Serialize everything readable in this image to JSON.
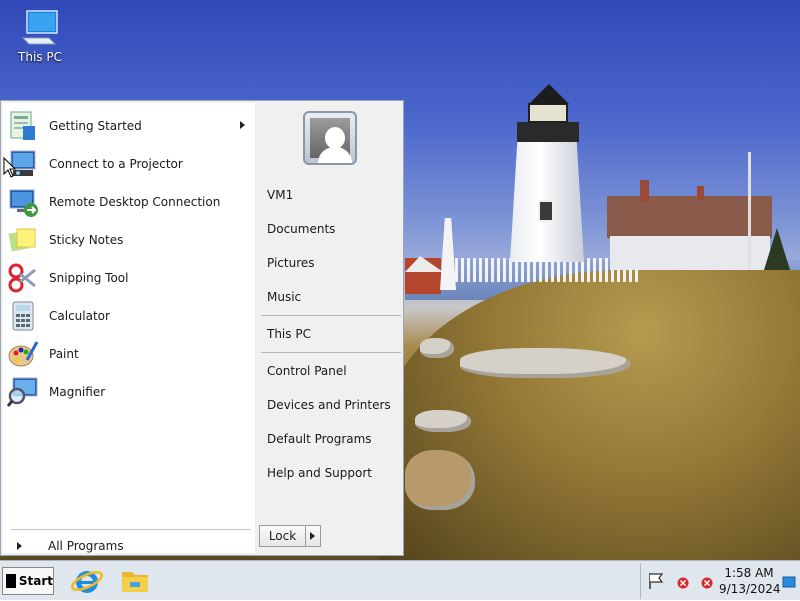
{
  "desktop": {
    "icons": [
      {
        "label": "This PC",
        "icon": "computer-icon"
      }
    ]
  },
  "start_menu": {
    "programs": [
      {
        "label": "Getting Started",
        "icon": "getting-started-icon",
        "has_submenu": true
      },
      {
        "label": "Connect to a Projector",
        "icon": "projector-icon"
      },
      {
        "label": "Remote Desktop Connection",
        "icon": "remote-desktop-icon"
      },
      {
        "label": "Sticky Notes",
        "icon": "sticky-notes-icon"
      },
      {
        "label": "Snipping Tool",
        "icon": "scissors-icon"
      },
      {
        "label": "Calculator",
        "icon": "calculator-icon"
      },
      {
        "label": "Paint",
        "icon": "paint-palette-icon"
      },
      {
        "label": "Magnifier",
        "icon": "magnifier-icon"
      }
    ],
    "all_programs": "All Programs",
    "right_items": {
      "user": "VM1",
      "documents": "Documents",
      "pictures": "Pictures",
      "music": "Music",
      "this_pc": "This PC",
      "control_panel": "Control Panel",
      "devices": "Devices and Printers",
      "default_programs": "Default Programs",
      "help": "Help and Support"
    },
    "lock_label": "Lock"
  },
  "taskbar": {
    "start_label": "Start",
    "pinned": [
      {
        "icon": "internet-explorer-icon"
      },
      {
        "icon": "file-explorer-icon"
      }
    ],
    "clock": {
      "time": "1:58 AM",
      "date": "9/13/2024"
    },
    "tray_icons": [
      "flag-icon",
      "error-icon",
      "error-icon",
      "desktop-icon"
    ]
  },
  "colors": {
    "taskbar_bg": "#dfe6ee",
    "menu_left_bg": "#ffffff",
    "menu_right_bg": "#f0f0f0"
  }
}
